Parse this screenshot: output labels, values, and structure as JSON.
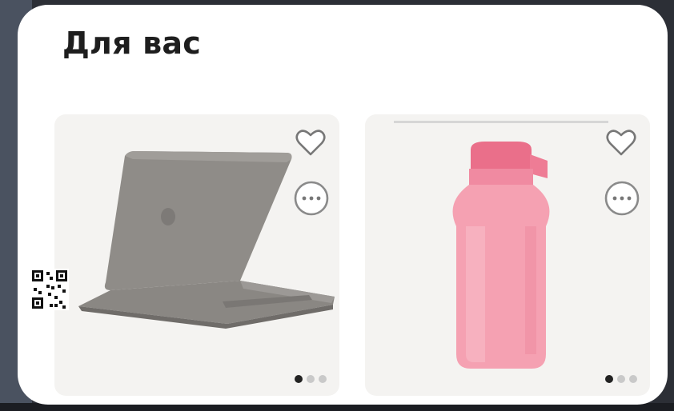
{
  "feed": {
    "title": "Для вас"
  },
  "products": [
    {
      "image_icon": "laptop-image",
      "favorite_icon": "heart-icon",
      "more_icon": "more-icon",
      "gallery_index": 1,
      "gallery_total": 3
    },
    {
      "image_icon": "water-bottle-image",
      "favorite_icon": "heart-icon",
      "more_icon": "more-icon",
      "gallery_index": 1,
      "gallery_total": 3
    }
  ],
  "colors": {
    "laptop": "#8f8c88",
    "bottle": "#f28fa4",
    "card_bg": "#f4f3f1"
  }
}
